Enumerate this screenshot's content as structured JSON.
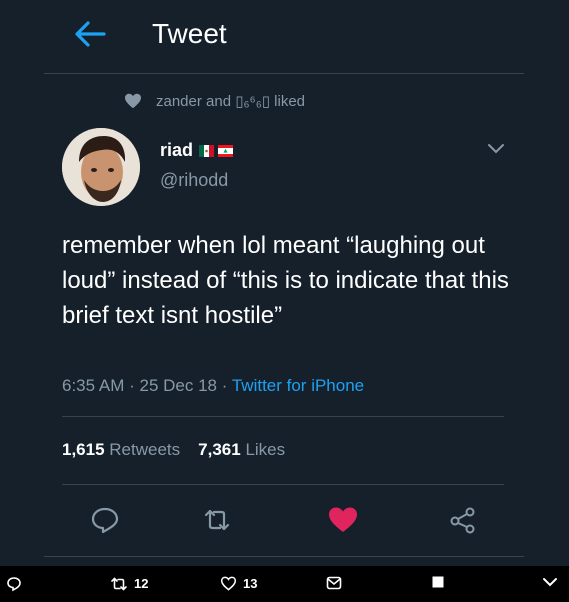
{
  "header": {
    "title": "Tweet"
  },
  "social_context": {
    "text": "zander and ▯₆⁶₆▯ liked"
  },
  "author": {
    "name": "riad",
    "handle": "@rihodd"
  },
  "tweet": {
    "text": "remember when lol meant “laughing out loud” instead of “this is to indicate that this brief text isnt hostile”",
    "time": "6:35 AM",
    "date": "25 Dec 18",
    "separator": "·",
    "source": "Twitter for iPhone"
  },
  "stats": {
    "retweets_count": "1,615",
    "retweets_label": "Retweets",
    "likes_count": "7,361",
    "likes_label": "Likes"
  },
  "bottom_bar": {
    "retweet_count": "12",
    "like_count": "13"
  },
  "colors": {
    "background": "#15202b",
    "accent": "#1da1f2",
    "like": "#e0245e",
    "muted": "#8899a6"
  }
}
